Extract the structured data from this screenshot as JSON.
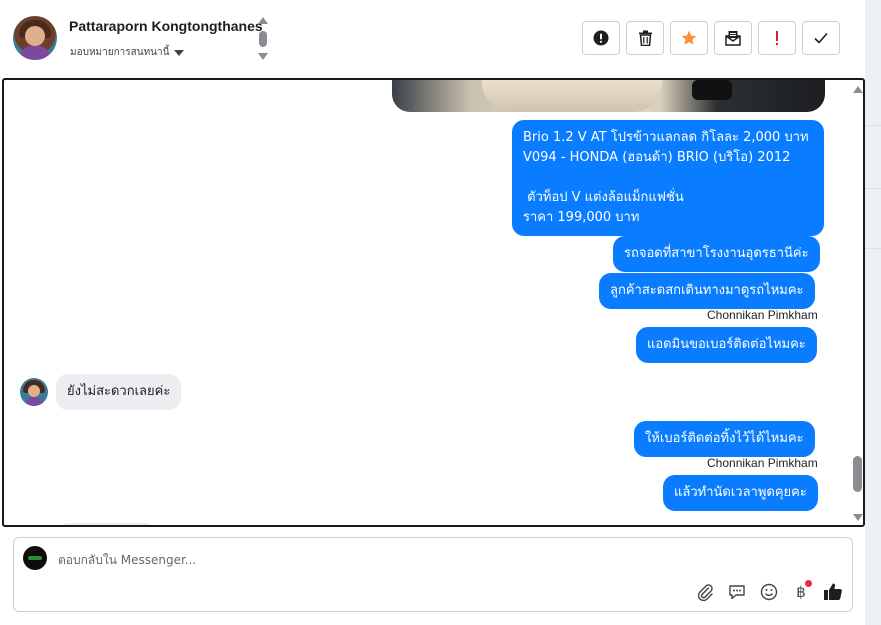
{
  "header": {
    "contact_name": "Pattaraporn Kongtongthanes",
    "assign_label": "มอบหมายการสนทนานี้",
    "toolbar": [
      {
        "name": "spam-button",
        "icon": "exclamation-circle-icon"
      },
      {
        "name": "delete-button",
        "icon": "trash-icon"
      },
      {
        "name": "star-button",
        "icon": "star-icon",
        "color": "#f7923b"
      },
      {
        "name": "mark-unread-button",
        "icon": "envelope-icon"
      },
      {
        "name": "important-button",
        "icon": "exclamation-icon",
        "color": "#e02020"
      },
      {
        "name": "mark-done-button",
        "icon": "check-icon"
      }
    ]
  },
  "messages": {
    "m1": "Brio 1.2 V AT โปรข้าวแลกลด กิโลละ 2,000 บาท\nV094 - HONDA (ฮอนด้า) BRIO (บริโอ) 2012\n\n ตัวท็อป V แต่งล้อแม็กแฟชั่น\nราคา 199,000 บาท",
    "m2": "รถจอดที่สาขาโรงงานอุดรธานีค่ะ",
    "m3": "ลูกค้าสะดสกเดินทางมาดูรถไหมคะ",
    "m3_sender": "Chonnikan Pimkham",
    "m4": "แอดมินขอเบอร์ติดต่อไหมคะ",
    "m5": "ยังไม่สะดวกเลยค่ะ",
    "m6": "ให้เบอร์ติดต่อทิ้งไว้ได้ไหมคะ",
    "m6_sender": "Chonnikan Pimkham",
    "m7": "แล้วทำนัดเวลาพูดคุยคะ"
  },
  "composer": {
    "placeholder": "ตอบกลับใน Messenger..."
  },
  "colors": {
    "outgoing_bubble": "#0a7cff",
    "incoming_bubble": "#eceef1",
    "like_icon": "#1c1e21"
  }
}
